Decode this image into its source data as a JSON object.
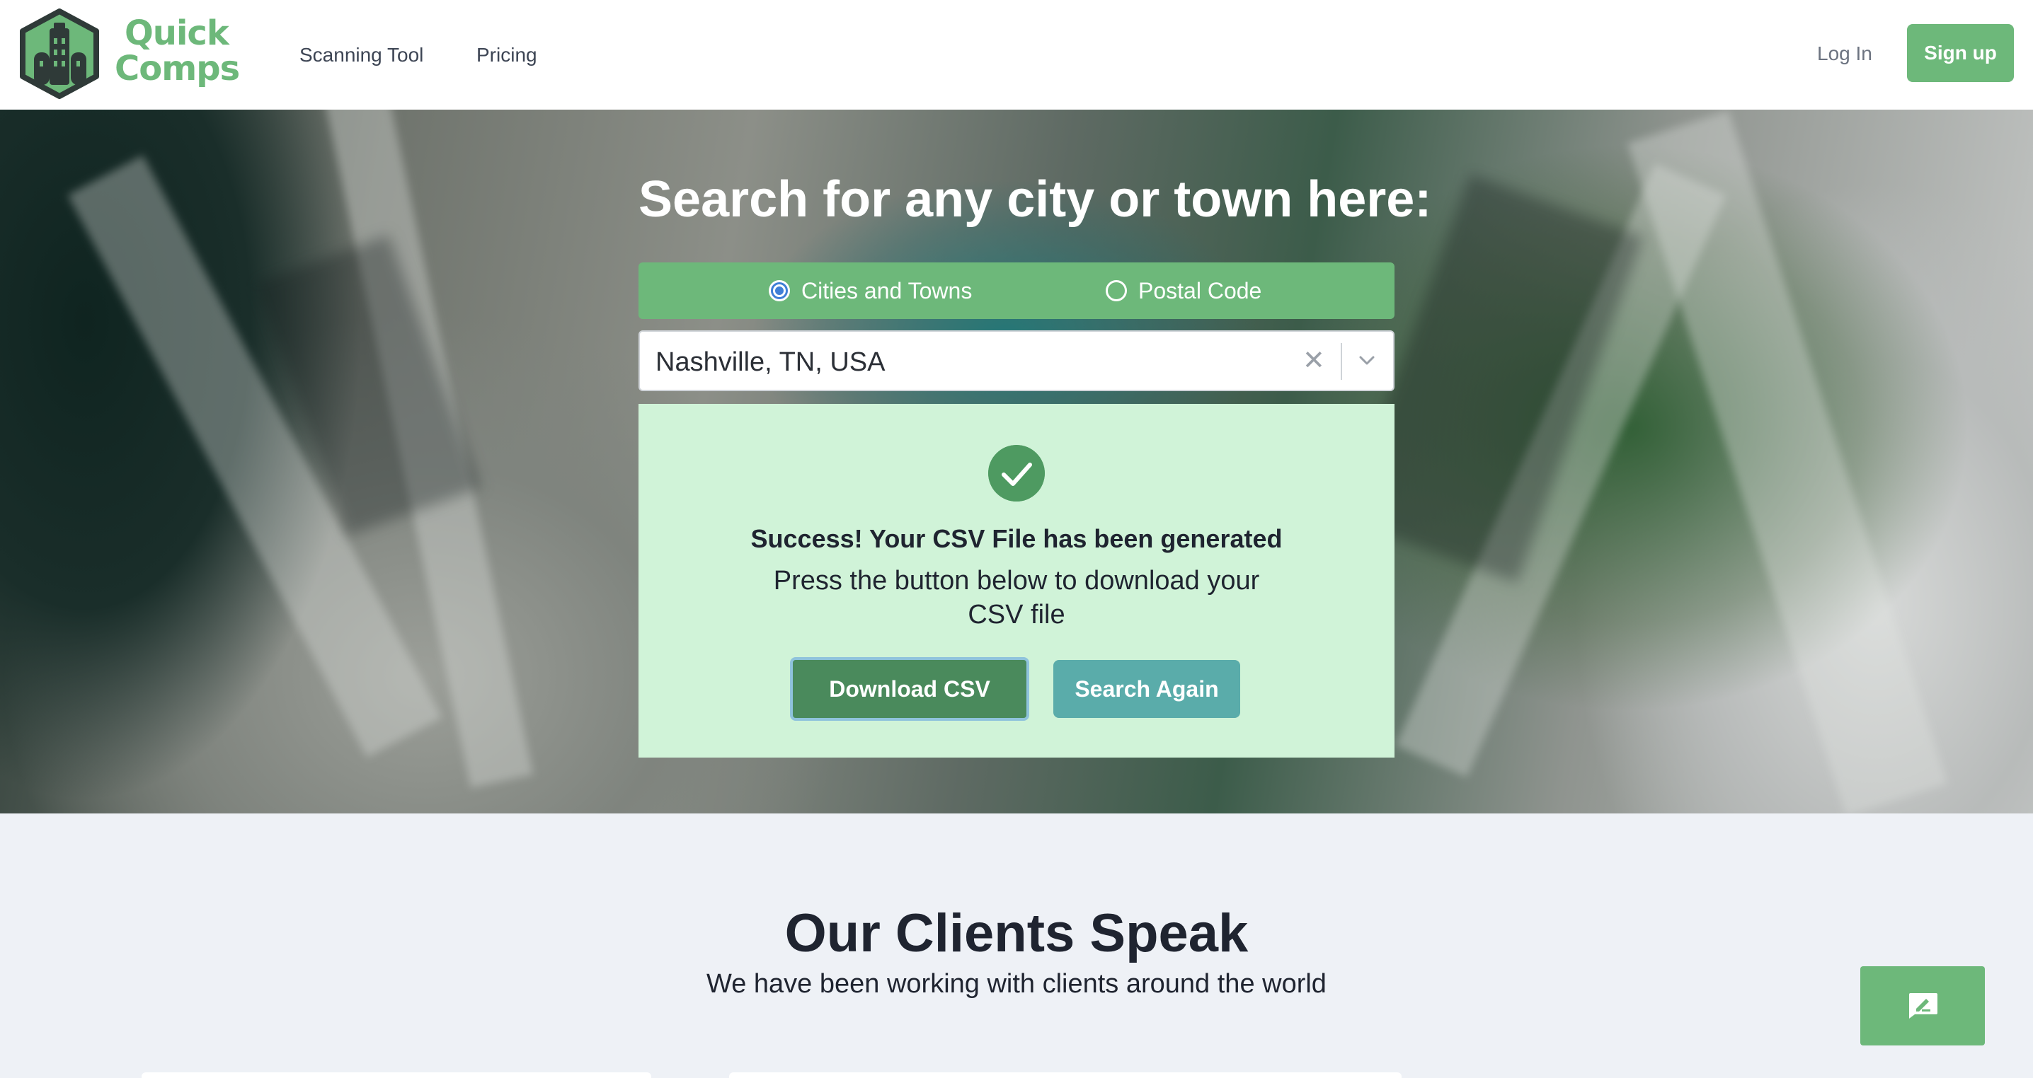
{
  "brand": {
    "line1": "Quick",
    "line2": "Comps"
  },
  "nav": {
    "links": [
      "Scanning Tool",
      "Pricing"
    ],
    "login": "Log In",
    "signup": "Sign up"
  },
  "hero": {
    "title": "Search for any city or town here:",
    "search_type": {
      "options": [
        "Cities and Towns",
        "Postal Code"
      ],
      "selected": "Cities and Towns"
    },
    "location_select": {
      "value": "Nashville, TN, USA",
      "clear_icon": "close-icon",
      "dropdown_icon": "chevron-down-icon"
    },
    "result": {
      "icon": "check-circle-icon",
      "title": "Success! Your CSV File has been generated",
      "message": "Press the button below to download your CSV file",
      "download_label": "Download CSV",
      "search_again_label": "Search Again"
    }
  },
  "clients": {
    "title": "Our Clients Speak",
    "subtitle": "We have been working with clients around the world"
  },
  "feedback": {
    "icon": "feedback-icon"
  },
  "colors": {
    "brand_green": "#6db87a",
    "dark_green": "#4a8a5c",
    "teal": "#5aacaa",
    "success_bg": "#d0f3d8",
    "page_bg": "#eef1f6"
  }
}
